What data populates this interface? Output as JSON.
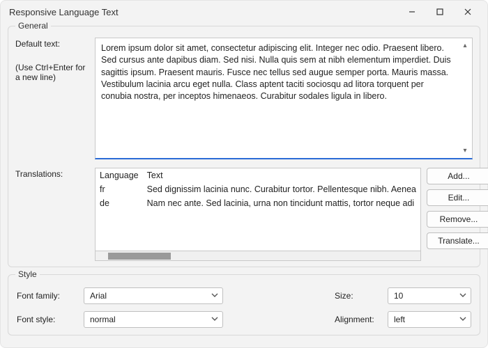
{
  "window": {
    "title": "Responsive Language Text"
  },
  "general": {
    "group_label": "General",
    "default_label": "Default text:",
    "hint": "(Use Ctrl+Enter for a new line)",
    "default_text": "Lorem ipsum dolor sit amet, consectetur adipiscing elit. Integer nec odio. Praesent libero. Sed cursus ante dapibus diam. Sed nisi. Nulla quis sem at nibh elementum imperdiet. Duis sagittis ipsum. Praesent mauris. Fusce nec tellus sed augue semper porta. Mauris massa. Vestibulum lacinia arcu eget nulla. Class aptent taciti sociosqu ad litora torquent per conubia nostra, per inceptos himenaeos. Curabitur sodales ligula in libero.",
    "translations_label": "Translations:",
    "columns": {
      "lang": "Language",
      "text": "Text"
    },
    "rows": [
      {
        "lang": "fr",
        "text": "Sed dignissim lacinia nunc. Curabitur tortor. Pellentesque nibh. Aenea"
      },
      {
        "lang": "de",
        "text": "Nam nec ante. Sed lacinia, urna non tincidunt mattis, tortor neque adi"
      }
    ],
    "buttons": {
      "add": "Add...",
      "edit": "Edit...",
      "remove": "Remove...",
      "translate": "Translate..."
    }
  },
  "style": {
    "group_label": "Style",
    "font_family_label": "Font family:",
    "font_family_value": "Arial",
    "font_style_label": "Font style:",
    "font_style_value": "normal",
    "size_label": "Size:",
    "size_value": "10",
    "alignment_label": "Alignment:",
    "alignment_value": "left"
  }
}
